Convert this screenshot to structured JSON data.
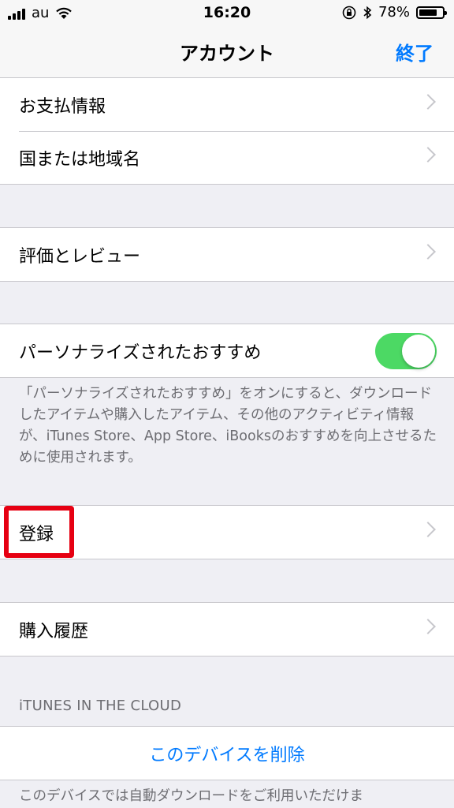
{
  "status_bar": {
    "carrier": "au",
    "time": "16:20",
    "battery": "78%",
    "battery_level": 0.78
  },
  "nav": {
    "title": "アカウント",
    "done": "終了"
  },
  "group1": {
    "payment": "お支払情報",
    "country": "国または地域名"
  },
  "group2": {
    "ratings": "評価とレビュー"
  },
  "group3": {
    "personalized": "パーソナライズされたおすすめ",
    "personalized_on": true,
    "footnote": "「パーソナライズされたおすすめ」をオンにすると、ダウンロードしたアイテムや購入したアイテム、その他のアクティビティ情報が、iTunes Store、App Store、iBooksのおすすめを向上させるために使用されます。"
  },
  "group4": {
    "subscriptions": "登録"
  },
  "group5": {
    "purchase_history": "購入履歴"
  },
  "cloud": {
    "header": "iTUNES IN THE CLOUD",
    "remove_device": "このデバイスを削除",
    "footnote": "このデバイスでは自動ダウンロードをご利用いただけま"
  },
  "colors": {
    "accent": "#007aff",
    "toggle_on": "#4cd964",
    "highlight": "#e60012"
  }
}
